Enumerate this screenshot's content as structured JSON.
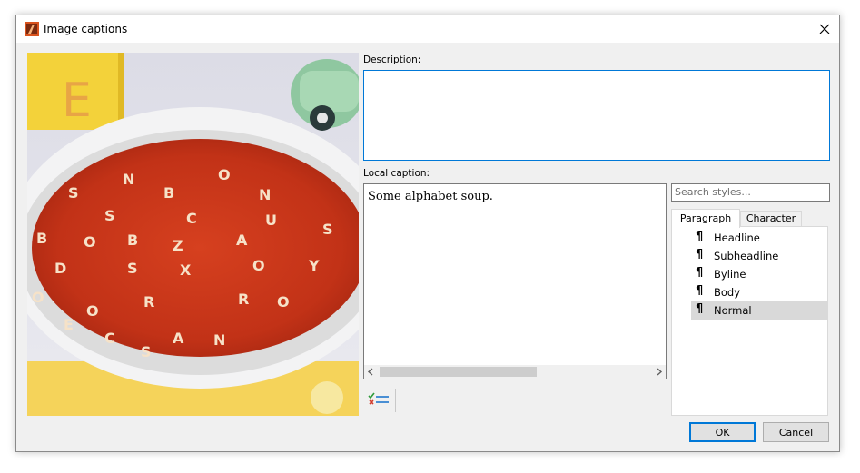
{
  "window": {
    "title": "Image captions"
  },
  "description": {
    "label": "Description:",
    "value": ""
  },
  "caption": {
    "label": "Local caption:",
    "value": "Some alphabet soup."
  },
  "styles": {
    "search_placeholder": "Search styles...",
    "tabs": [
      "Paragraph",
      "Character"
    ],
    "active_tab": "Paragraph",
    "items": [
      {
        "label": "Headline",
        "icon": "pilcrow-icon"
      },
      {
        "label": "Subheadline",
        "icon": "pilcrow-icon"
      },
      {
        "label": "Byline",
        "icon": "pilcrow-icon"
      },
      {
        "label": "Body",
        "icon": "pilcrow-icon"
      },
      {
        "label": "Normal",
        "icon": "pilcrow-icon"
      }
    ],
    "selected": "Normal",
    "pilcrow_glyph": "¶"
  },
  "buttons": {
    "ok": "OK",
    "cancel": "Cancel"
  },
  "colors": {
    "accent": "#0078d7",
    "soup": "#c8321a",
    "selection": "#d9d9d9"
  }
}
